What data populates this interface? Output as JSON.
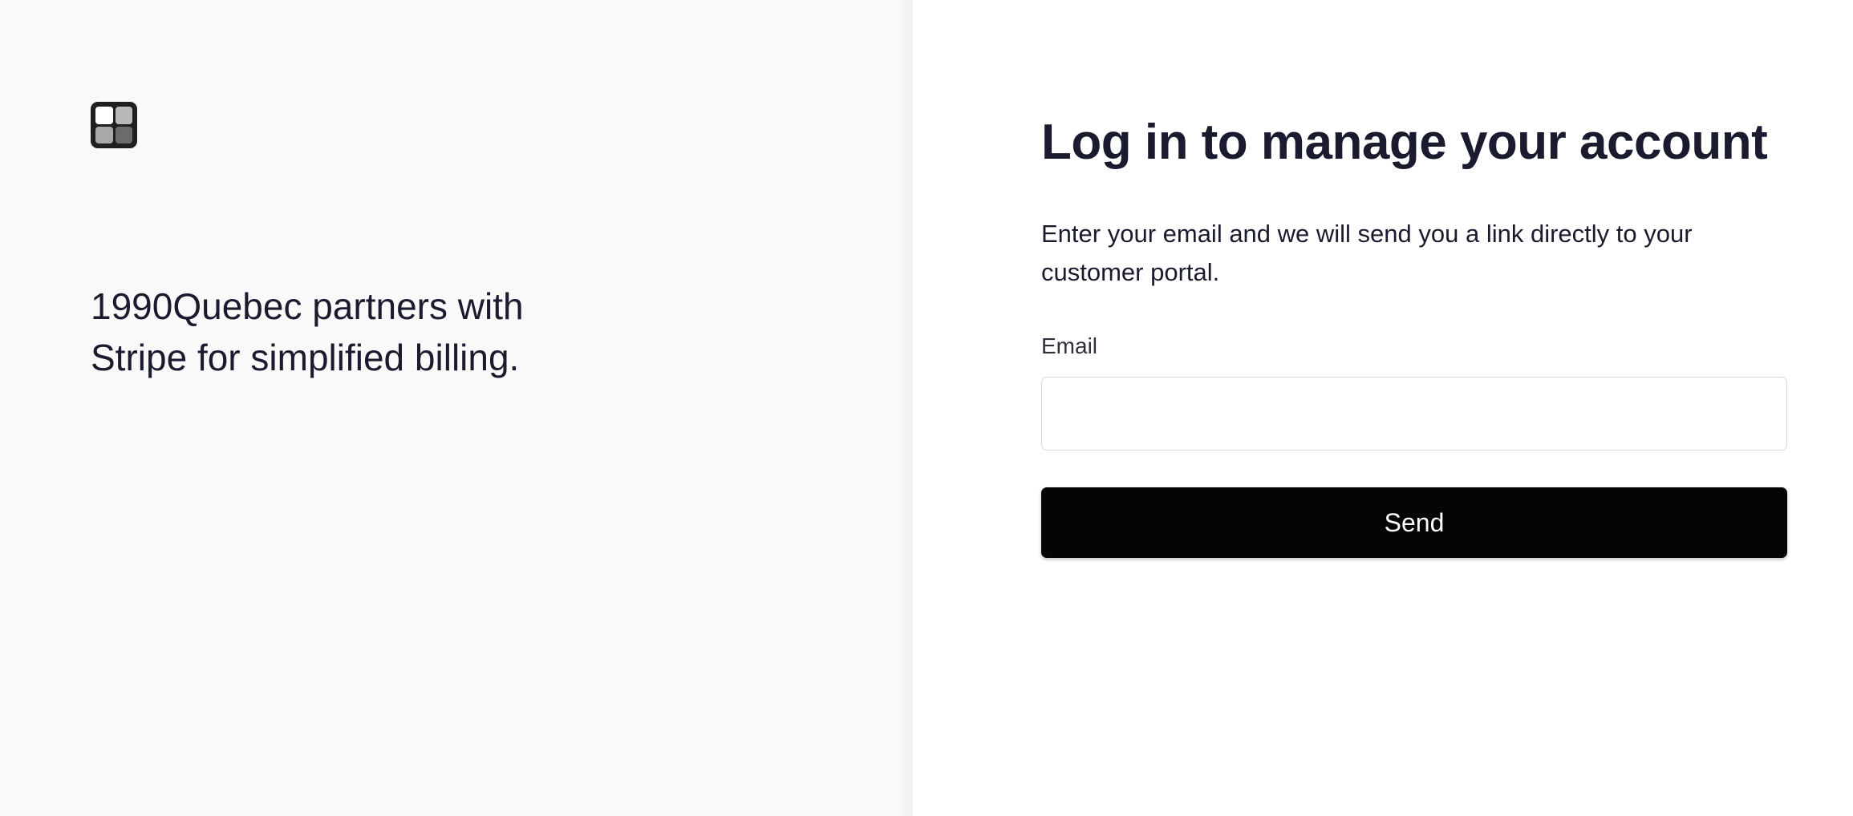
{
  "left_panel": {
    "logo_icon": "grid-logo-icon",
    "tagline_line1": "1990Quebec partners with",
    "tagline_line2": "Stripe for simplified billing."
  },
  "right_panel": {
    "heading": "Log in to manage your account",
    "description": "Enter your email and we will send you a link directly to your customer portal.",
    "email_label": "Email",
    "email_value": "",
    "send_label": "Send"
  },
  "colors": {
    "left_background": "#f9f9f9",
    "right_background": "#ffffff",
    "text": "#1a1b2e",
    "button_background": "#050505",
    "button_text": "#ffffff"
  }
}
